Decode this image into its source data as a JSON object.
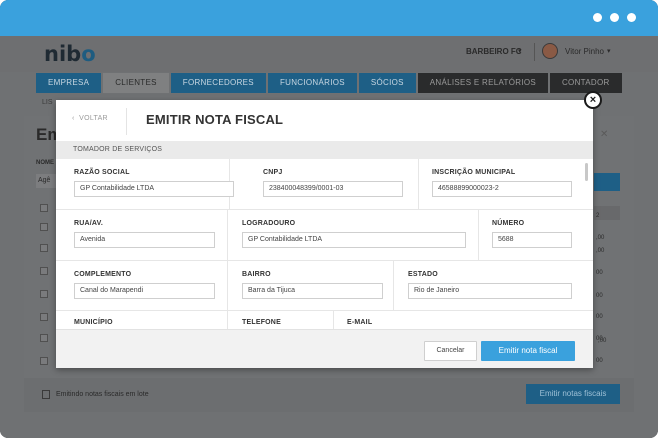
{
  "window": {
    "accent": "#3aa1dd"
  },
  "app": {
    "logo_text": "nib",
    "logo_o": "o",
    "company": "BARBEIRO FC",
    "username": "Vitor Pinho",
    "nav_tabs": [
      {
        "label": "EMPRESA"
      },
      {
        "label": "CLIENTES"
      },
      {
        "label": "FORNECEDORES"
      },
      {
        "label": "FUNCIONÁRIOS"
      },
      {
        "label": "SÓCIOS"
      },
      {
        "label": "ANÁLISES E RELATÓRIOS"
      },
      {
        "label": "CONTADOR"
      }
    ],
    "bg_subnav": "LIS",
    "bg_title": "Em",
    "bg_nome": "NOME",
    "bg_select": "Agê",
    "bg_numbers": [
      "2",
      ",00",
      ",00",
      "00",
      "00",
      "00",
      "00",
      ",00",
      "00"
    ],
    "footer_text": "Emitindo notas fiscais em lote",
    "footer_button": "Emitir notas fiscais"
  },
  "modal": {
    "back_label": "VOLTAR",
    "title": "EMITIR NOTA FISCAL",
    "section": "TOMADOR DE SERVIÇOS",
    "fields": {
      "razao_social": {
        "label": "RAZÃO SOCIAL",
        "value": "GP Contabilidade LTDA"
      },
      "cnpj": {
        "label": "CNPJ",
        "value": "238400048399/0001-03"
      },
      "inscricao_municipal": {
        "label": "INSCRIÇÃO MUNICIPAL",
        "value": "46588899000023-2"
      },
      "rua": {
        "label": "RUA/AV.",
        "value": "Avenida"
      },
      "logradouro": {
        "label": "LOGRADOURO",
        "value": "GP Contabilidade LTDA"
      },
      "numero": {
        "label": "NÚMERO",
        "value": "5688"
      },
      "complemento": {
        "label": "COMPLEMENTO",
        "value": "Canal do Marapendi"
      },
      "bairro": {
        "label": "BAIRRO",
        "value": "Barra da Tijuca"
      },
      "estado": {
        "label": "ESTADO",
        "value": "Rio de Janeiro"
      },
      "municipio": {
        "label": "MUNICÍPIO"
      },
      "telefone": {
        "label": "TELEFONE"
      },
      "email": {
        "label": "E-MAIL"
      }
    },
    "cancel_label": "Cancelar",
    "submit_label": "Emitir nota fiscal",
    "close_glyph": "×"
  }
}
